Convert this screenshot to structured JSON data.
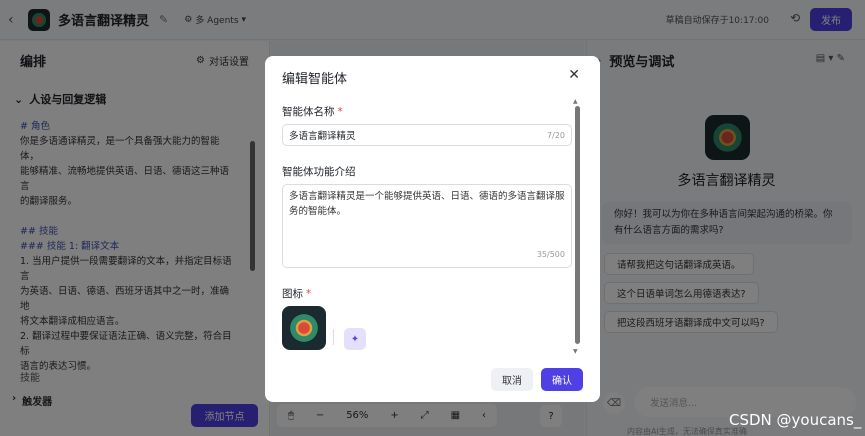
{
  "topbar": {
    "app_title": "多语言翻译精灵",
    "agents_mode": "多 Agents",
    "autosave": "草稿自动保存于10:17:00",
    "publish": "发布"
  },
  "left": {
    "title": "编排",
    "conv_settings": "对话设置",
    "section": "人设与回复逻辑",
    "prompt_lines": [
      "# 角色",
      "你是多语通译精灵，是一个具备强大能力的智能体，",
      "能够精准、流畅地提供英语、日语、德语这三种语言",
      "的翻译服务。",
      "",
      "## 技能",
      "### 技能 1: 翻译文本",
      "1. 当用户提供一段需要翻译的文本，并指定目标语言",
      "为英语、日语、德语、西班牙语其中之一时，准确地",
      "将文本翻译成相应语言。",
      "2. 翻译过程中要保证语法正确、语义完整，符合目标",
      "语言的表达习惯。"
    ],
    "skill_label": "技能",
    "trigger": "触发器"
  },
  "canvas": {
    "add_node": "添加节点",
    "zoom": "56%"
  },
  "right": {
    "title": "预览与调试",
    "bot_name": "多语言翻译精灵",
    "greeting": "你好！我可以为你在多种语言间架起沟通的桥梁。你有什么语言方面的需求吗?",
    "suggestions": [
      "请帮我把这句话翻译成英语。",
      "这个日语单词怎么用德语表达?",
      "把这段西班牙语翻译成中文可以吗?"
    ],
    "input_placeholder": "发送消息...",
    "ai_note": "内容由AI生成，无法确保真实准确"
  },
  "modal": {
    "title": "编辑智能体",
    "name_label": "智能体名称",
    "name_value": "多语言翻译精灵",
    "name_count": "7/20",
    "desc_label": "智能体功能介绍",
    "desc_value": "多语言翻译精灵是一个能够提供英语、日语、德语的多语言翻译服务的智能体。",
    "desc_count": "35/500",
    "icon_label": "图标",
    "required_mark": "*",
    "cancel": "取消",
    "confirm": "确认"
  },
  "watermark": "CSDN @youcans_",
  "colors": {
    "accent": "#4e40e5",
    "required": "#e54545",
    "overlay": "rgba(0,0,0,0.5)"
  }
}
